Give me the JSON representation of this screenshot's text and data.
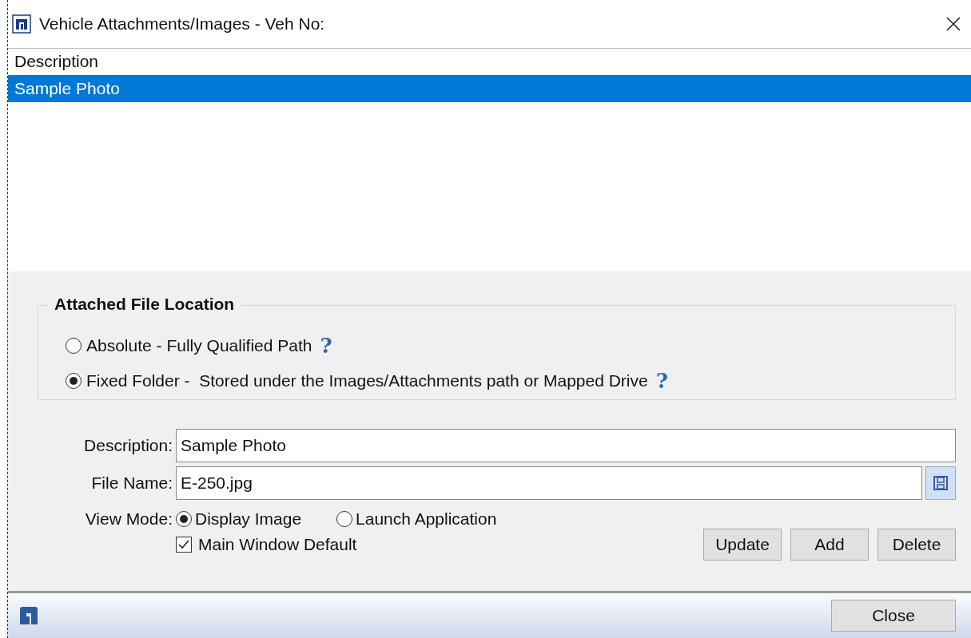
{
  "window": {
    "title": "Vehicle Attachments/Images - Veh No:"
  },
  "list": {
    "columns": [
      "Description"
    ],
    "rows": [
      {
        "description": "Sample Photo",
        "selected": true
      }
    ]
  },
  "location_group": {
    "title": "Attached File Location",
    "options": [
      {
        "label": "Absolute - Fully Qualified Path",
        "selected": false,
        "help": "?"
      },
      {
        "label": "Fixed Folder -  Stored under the Images/Attachments path or Mapped Drive",
        "selected": true,
        "help": "?"
      }
    ]
  },
  "form": {
    "description": {
      "label": "Description:",
      "value": "Sample Photo"
    },
    "file_name": {
      "label": "File Name:",
      "value": "E-250.jpg"
    },
    "view_mode": {
      "label": "View Mode:",
      "options": [
        {
          "label": "Display Image",
          "selected": true
        },
        {
          "label": "Launch Application",
          "selected": false
        }
      ]
    },
    "main_window_default": {
      "label": "Main Window Default",
      "checked": true
    }
  },
  "buttons": [
    "Update",
    "Add",
    "Delete"
  ],
  "footer": {
    "close_button": "Close"
  }
}
